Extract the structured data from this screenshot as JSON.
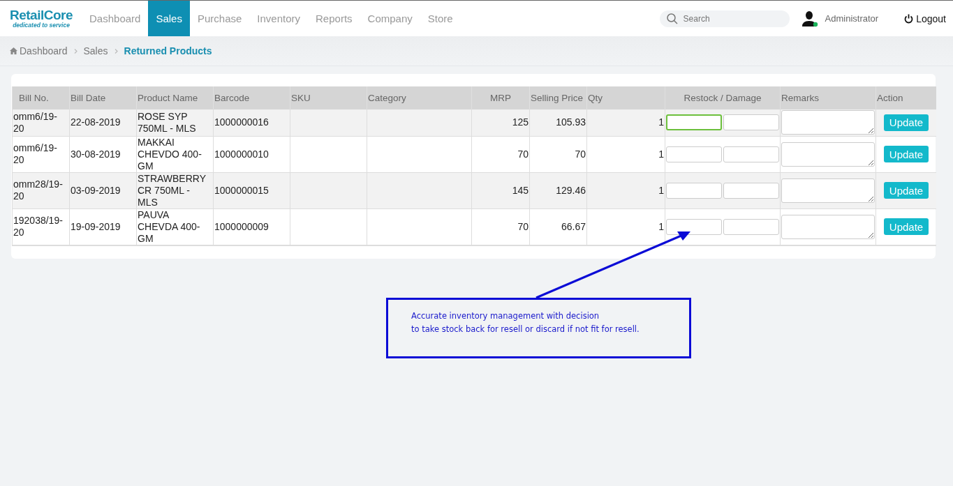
{
  "brand": {
    "name": "RetailCore",
    "tagline": "dedicated to service"
  },
  "nav": [
    {
      "label": "Dashboard",
      "selected": false
    },
    {
      "label": "Sales",
      "selected": true
    },
    {
      "label": "Purchase",
      "selected": false
    },
    {
      "label": "Inventory",
      "selected": false
    },
    {
      "label": "Reports",
      "selected": false
    },
    {
      "label": "Company",
      "selected": false
    },
    {
      "label": "Store",
      "selected": false
    }
  ],
  "search": {
    "placeholder": "Search"
  },
  "user": {
    "name": "Administrator",
    "online": true
  },
  "logout": "Logout",
  "breadcrumb": [
    {
      "label": "Dashboard",
      "current": false
    },
    {
      "label": "Sales",
      "current": false
    },
    {
      "label": "Returned Products",
      "current": true
    }
  ],
  "table": {
    "columns": [
      "Bill No.",
      "Bill Date",
      "Product Name",
      "Barcode",
      "SKU",
      "Category",
      "MRP",
      "Selling Price",
      "Qty",
      "Restock / Damage",
      "Remarks",
      "Action"
    ],
    "rows": [
      {
        "bill_no": "omm6/19-20",
        "bill_date": "22-08-2019",
        "product": "ROSE SYP 750ML - MLS",
        "barcode": "1000000016",
        "mrp": "125",
        "selling_price": "105.93",
        "qty": "1",
        "restock_focused": true,
        "action": "Update"
      },
      {
        "bill_no": "omm6/19-20",
        "bill_date": "30-08-2019",
        "product": "MAKKAI CHEVDO 400-GM",
        "barcode": "1000000010",
        "mrp": "70",
        "selling_price": "70",
        "qty": "1",
        "restock_focused": false,
        "action": "Update"
      },
      {
        "bill_no": "omm28/19-20",
        "bill_date": "03-09-2019",
        "product": "STRAWBERRY CR 750ML - MLS",
        "barcode": "1000000015",
        "mrp": "145",
        "selling_price": "129.46",
        "qty": "1",
        "restock_focused": false,
        "action": "Update"
      },
      {
        "bill_no": "192038/19-20",
        "bill_date": "19-09-2019",
        "product": "PAUVA CHEVDA 400-GM",
        "barcode": "1000000009",
        "mrp": "70",
        "selling_price": "66.67",
        "qty": "1",
        "restock_focused": false,
        "action": "Update"
      }
    ]
  },
  "annotation": {
    "lines": [
      "Accurate inventory management with decision",
      "to take stock back for resell or discard if not fit for resell."
    ]
  }
}
